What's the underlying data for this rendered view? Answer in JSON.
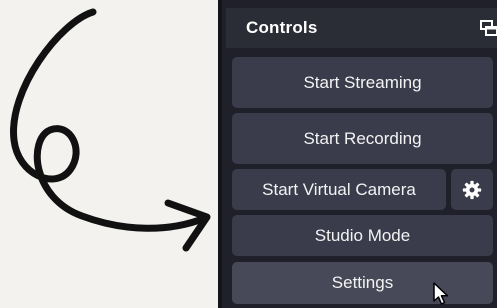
{
  "dock": {
    "title": "Controls",
    "undock_icon": "undock-icon"
  },
  "buttons": {
    "start_streaming": "Start Streaming",
    "start_recording": "Start Recording",
    "start_virtual_camera": "Start Virtual Camera",
    "studio_mode": "Studio Mode",
    "settings": "Settings"
  },
  "icons": {
    "gear": "gear-icon",
    "cursor": "mouse-pointer-icon",
    "arrow": "curved-arrow-icon"
  },
  "colors": {
    "dock_bg": "#1f2029",
    "titlebar_bg": "#2a2c36",
    "button_bg": "#3a3c4b",
    "button_hover_bg": "#474958",
    "text": "#f3f3f3"
  }
}
